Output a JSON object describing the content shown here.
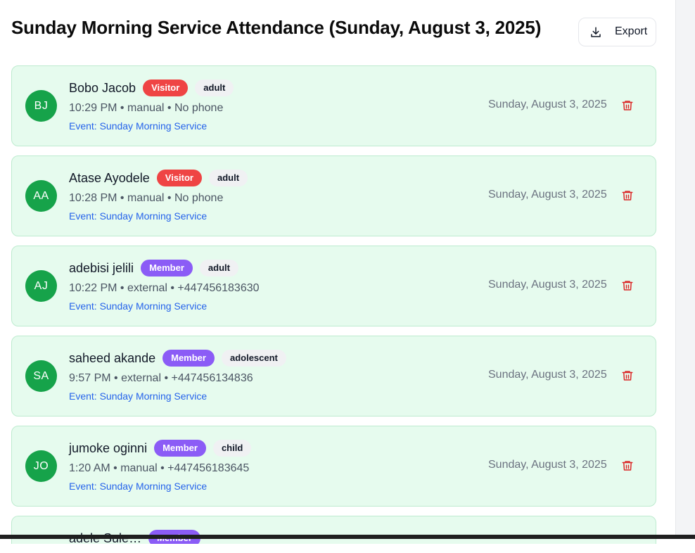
{
  "page": {
    "title": "Sunday Morning Service Attendance (Sunday, August 3, 2025)",
    "export_label": "Export"
  },
  "colors": {
    "visitor": "#ef4444",
    "member": "#8b5cf6",
    "avatar": "#16a34a",
    "card_bg": "#e6fbee",
    "card_border": "#bdebcf",
    "delete": "#dc2626",
    "event_link": "#2563eb"
  },
  "icons": {
    "export": "download-icon",
    "delete": "trash-icon"
  },
  "attendance": [
    {
      "initials": "BJ",
      "name": "Bobo Jacob",
      "type": "Visitor",
      "age_group": "adult",
      "meta": "10:29 PM • manual • No phone",
      "event": "Event: Sunday Morning Service",
      "date": "Sunday, August 3, 2025"
    },
    {
      "initials": "AA",
      "name": "Atase Ayodele",
      "type": "Visitor",
      "age_group": "adult",
      "meta": "10:28 PM • manual • No phone",
      "event": "Event: Sunday Morning Service",
      "date": "Sunday, August 3, 2025"
    },
    {
      "initials": "AJ",
      "name": "adebisi jelili",
      "type": "Member",
      "age_group": "adult",
      "meta": "10:22 PM • external • +447456183630",
      "event": "Event: Sunday Morning Service",
      "date": "Sunday, August 3, 2025"
    },
    {
      "initials": "SA",
      "name": "saheed akande",
      "type": "Member",
      "age_group": "adolescent",
      "meta": "9:57 PM • external • +447456134836",
      "event": "Event: Sunday Morning Service",
      "date": "Sunday, August 3, 2025"
    },
    {
      "initials": "JO",
      "name": "jumoke oginni",
      "type": "Member",
      "age_group": "child",
      "meta": "1:20 AM • manual • +447456183645",
      "event": "Event: Sunday Morning Service",
      "date": "Sunday, August 3, 2025"
    }
  ],
  "partial_row": {
    "name": "adele Sule…",
    "type": "Member"
  }
}
